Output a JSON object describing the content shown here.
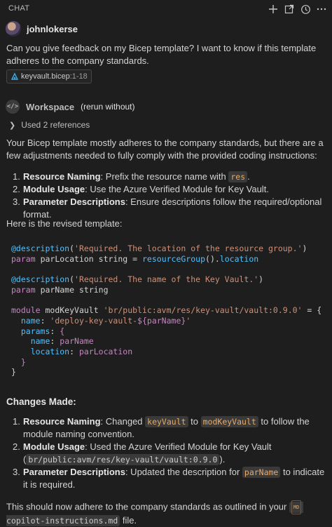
{
  "header": {
    "title": "CHAT",
    "icons": [
      "plus-icon",
      "new-window-icon",
      "history-icon",
      "more-icon"
    ]
  },
  "user": {
    "name": "johnlokerse",
    "message": "Can you give feedback on my Bicep template? I want to know if this template adheres to the company standards.",
    "attachment": {
      "file": "keyvault.bicep",
      "range": ":1-18"
    }
  },
  "agent": {
    "name": "Workspace",
    "rerun": "(rerun without)",
    "references": "Used 2 references"
  },
  "response": {
    "intro": "Your Bicep template mostly adheres to the company standards, but there are a few adjustments needed to fully comply with the provided coding instructions:",
    "items": [
      {
        "num": "1.",
        "title": "Resource Naming",
        "text": ": Prefix the resource name with ",
        "code": "res",
        "tail": "."
      },
      {
        "num": "2.",
        "title": "Module Usage",
        "text": ": Use the Azure Verified Module for Key Vault."
      },
      {
        "num": "3.",
        "title": "Parameter Descriptions",
        "text": ": Ensure descriptions follow the required/optional format."
      }
    ],
    "revised_label": "Here is the revised template:",
    "code": {
      "l1_dec": "@description",
      "l1_str": "'Required. The location of the resource group.'",
      "l2_kw": "param",
      "l2_name": "parLocation",
      "l2_type": "string",
      "l2_fn": "resourceGroup",
      "l2_prop": "location",
      "l4_dec": "@description",
      "l4_str": "'Required. The name of the Key Vault.'",
      "l5_kw": "param",
      "l5_name": "parName",
      "l5_type": "string",
      "l7_kw": "module",
      "l7_name": "modKeyVault",
      "l7_str": "'br/public:avm/res/key-vault/vault:0.9.0'",
      "l8_key": "name",
      "l8_str": "'deploy-key-vault-",
      "l8_var": "parName",
      "l9_key": "params",
      "l10_key": "name",
      "l10_val": "parName",
      "l11_key": "location",
      "l11_val": "parLocation"
    },
    "changes_heading": "Changes Made:",
    "changes": {
      "c1_num": "1.",
      "c1_title": "Resource Naming",
      "c1_a": ": Changed ",
      "c1_code1": "keyVault",
      "c1_b": " to ",
      "c1_code2": "modKeyVault",
      "c1_c": " to follow the module naming convention.",
      "c2_num": "2.",
      "c2_title": "Module Usage",
      "c2_a": ": Used the Azure Verified Module for Key Vault (",
      "c2_code": "br/public:avm/res/key-vault/vault:0.9.0",
      "c2_b": ").",
      "c3_num": "3.",
      "c3_title": "Parameter Descriptions",
      "c3_a": ": Updated the description for ",
      "c3_code": "parName",
      "c3_b": " to indicate it is required."
    },
    "footer_a": "This should now adhere to the company standards as outlined in your ",
    "footer_file_badge": "MD",
    "footer_file": "copilot-instructions.md",
    "footer_b": " file."
  }
}
